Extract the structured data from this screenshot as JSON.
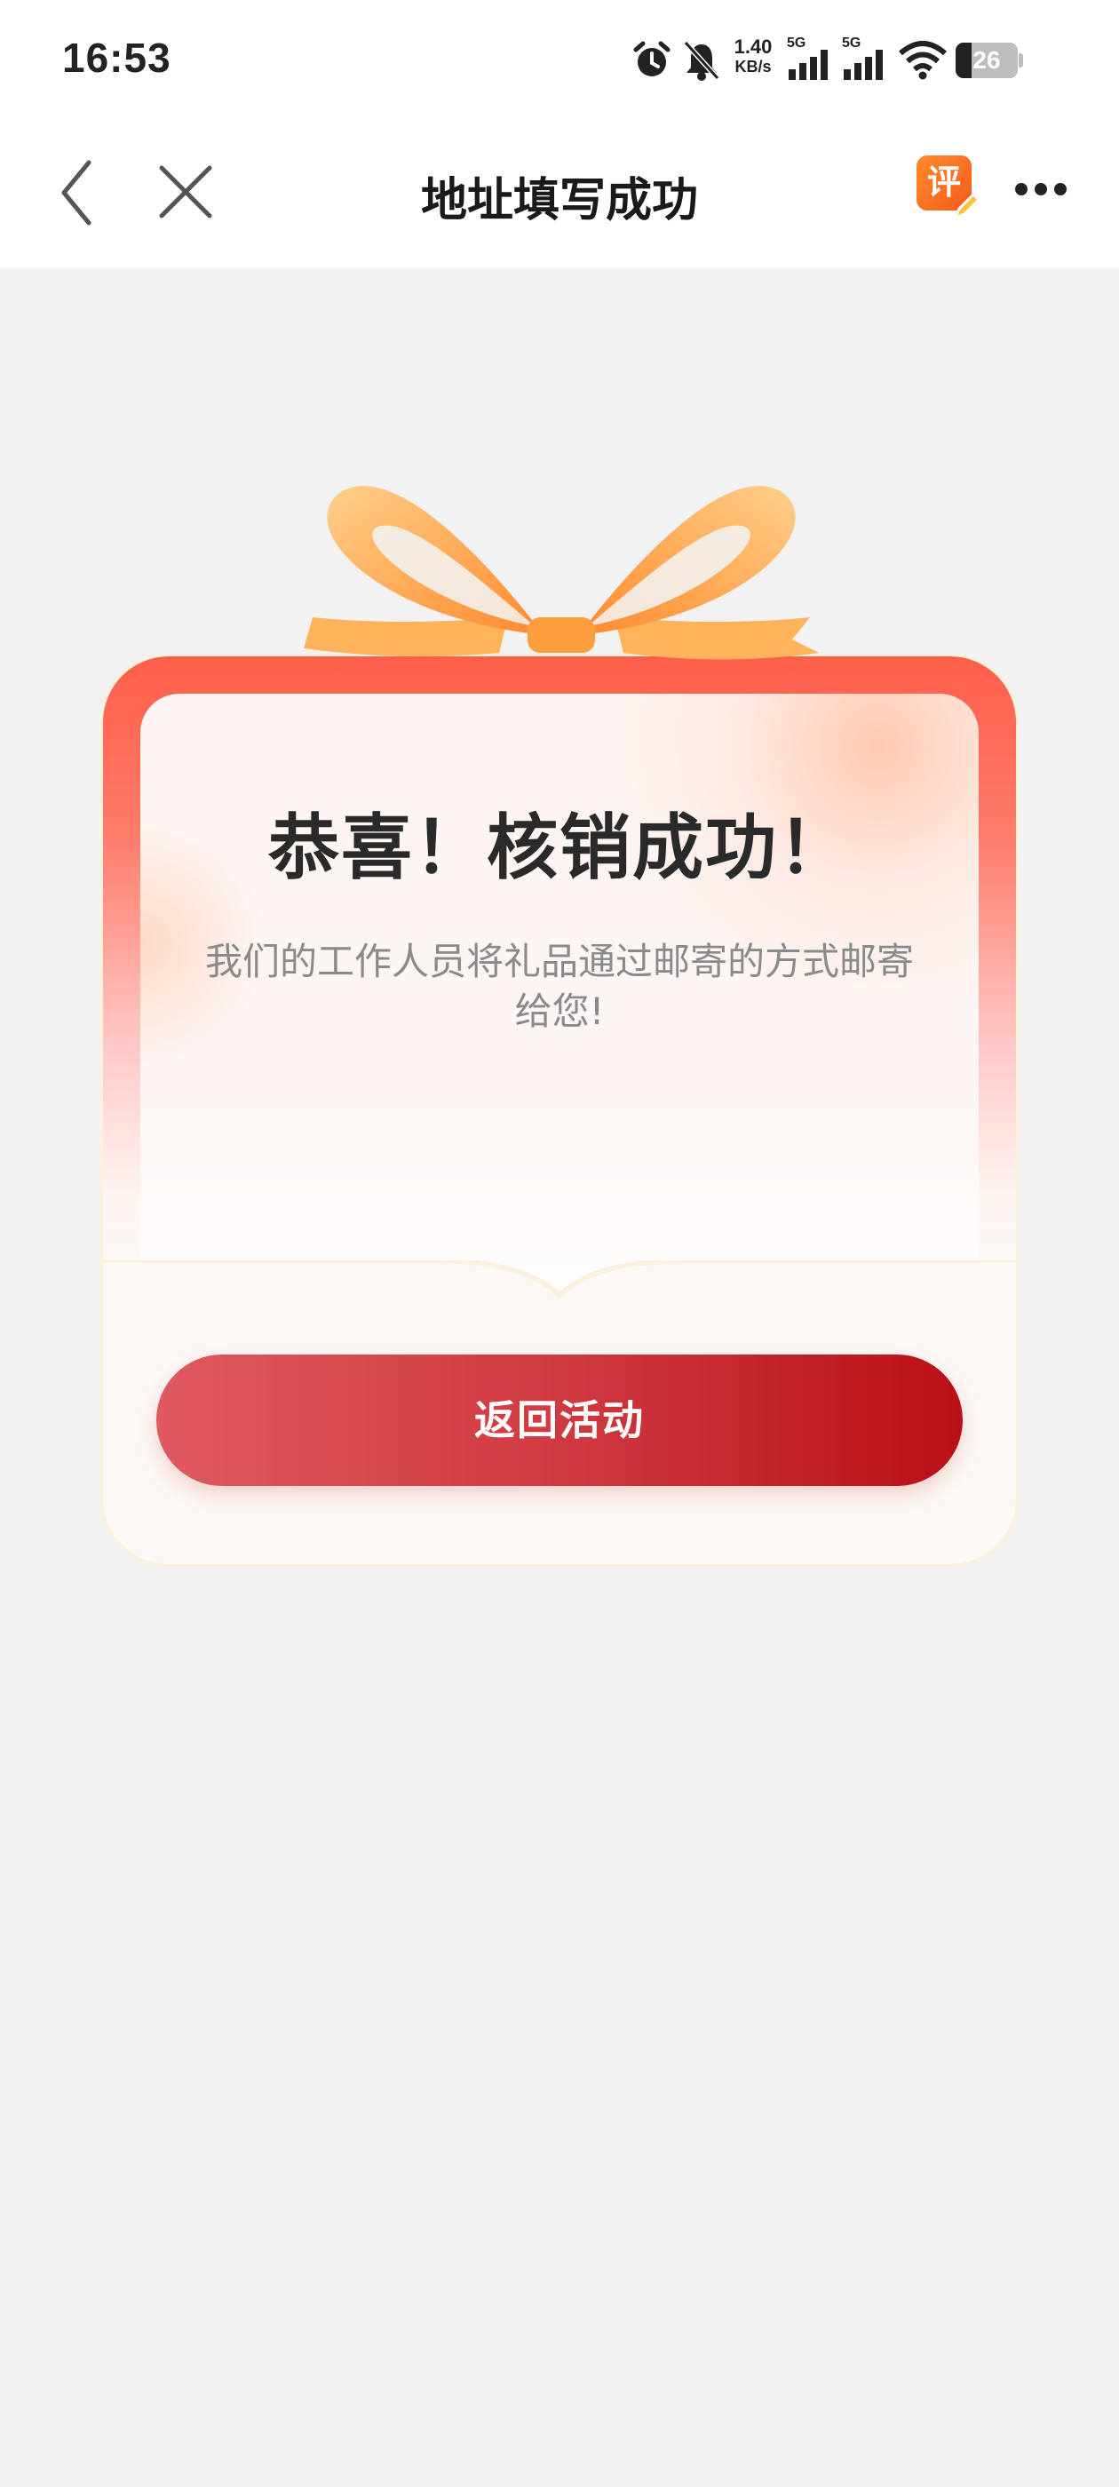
{
  "status_bar": {
    "time": "16:53",
    "net_speed_value": "1.40",
    "net_speed_unit": "KB/s",
    "sim1_label": "5G",
    "sim2_label": "5G",
    "battery_level": "26",
    "icons": [
      "alarm-icon",
      "bell-muted-icon",
      "signal-icon",
      "signal-icon",
      "wifi-icon",
      "battery-icon"
    ]
  },
  "nav": {
    "title": "地址填写成功",
    "review_badge": "评",
    "icons": [
      "back-arrow-icon",
      "close-icon",
      "review-icon",
      "more-icon"
    ]
  },
  "card": {
    "title": "恭喜！核销成功！",
    "description": "我们的工作人员将礼品通过邮寄的方式邮寄给您!",
    "button_label": "返回活动"
  },
  "colors": {
    "button_start": "#df5a60",
    "button_end": "#b81016",
    "card_border_top": "#ff5e4a",
    "bow": "#ff9a3c",
    "page_background": "#f2f2f2"
  }
}
